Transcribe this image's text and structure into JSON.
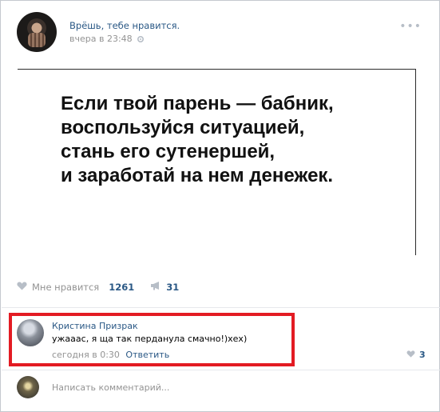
{
  "post": {
    "author_name": "Врёшь, тебе нравится.",
    "timestamp": "вчера в 23:48",
    "image_text": "Если твой парень — бабник,\nвоспользуйся ситуацией,\nстань его сутенершей,\nи заработай на нем денежек.",
    "like_label": "Мне нравится",
    "like_count": "1261",
    "share_count": "31"
  },
  "comment": {
    "author": "Кристина Призрак",
    "text": "ужааас, я ща так перданула смачно!)хех)",
    "timestamp": "сегодня в 0:30",
    "reply_label": "Ответить",
    "like_count": "3"
  },
  "write_comment": {
    "placeholder": "Написать комментарий..."
  },
  "colors": {
    "link": "#2a5885",
    "muted": "#939393",
    "highlight": "#e31b23"
  },
  "icons": [
    "gear-icon",
    "more-icon",
    "heart-icon",
    "megaphone-icon"
  ]
}
